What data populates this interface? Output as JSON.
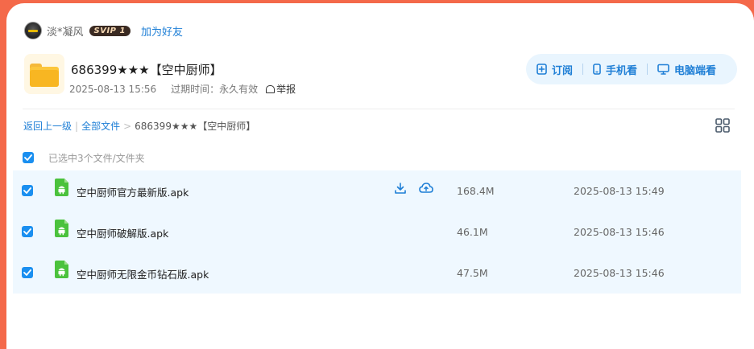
{
  "user": {
    "name": "淡*凝风",
    "vip_badge": "SVIP 1",
    "add_friend": "加为好友"
  },
  "share": {
    "title": "686399★★★【空中厨师】",
    "created": "2025-08-13 15:56",
    "expire": "过期时间：永久有效",
    "report": "举报"
  },
  "actions": {
    "subscribe": "订阅",
    "mobile": "手机看",
    "desktop": "电脑端看"
  },
  "breadcrumb": {
    "back": "返回上一级",
    "all_files": "全部文件",
    "current": "686399★★★【空中厨师】"
  },
  "selection": {
    "text": "已选中3个文件/文件夹"
  },
  "files": [
    {
      "name": "空中厨师官方最新版.apk",
      "size": "168.4M",
      "date": "2025-08-13 15:49"
    },
    {
      "name": "空中厨师破解版.apk",
      "size": "46.1M",
      "date": "2025-08-13 15:46"
    },
    {
      "name": "空中厨师无限金币钻石版.apk",
      "size": "47.5M",
      "date": "2025-08-13 15:46"
    }
  ],
  "colors": {
    "background": "#f4694a",
    "accent": "#1f7fd6",
    "checkbox": "#1a8ff0",
    "row_bg": "#eff8ff",
    "apk_icon": "#4bc23d"
  },
  "icons": [
    "avatar",
    "folder-icon",
    "report-icon",
    "subscribe-icon",
    "phone-icon",
    "monitor-icon",
    "grid-view-icon",
    "checkbox-checked-icon",
    "apk-file-icon",
    "download-icon",
    "cloud-save-icon"
  ]
}
